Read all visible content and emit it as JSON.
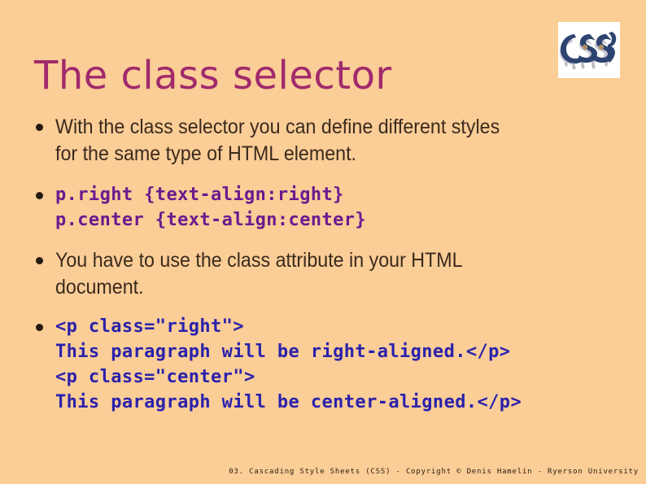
{
  "slide": {
    "title": "The class selector",
    "background_color": "#fbcd97",
    "title_color": "#a02a6c",
    "body_color": "#3a2a1c",
    "code_purple_color": "#6b1a8e",
    "code_blue_color": "#2a22ab"
  },
  "logo": {
    "alt": "CSS logo",
    "text": "C·S·S}",
    "letters_color": "#2d4370",
    "shadow_color": "#b9b9c4",
    "box_color": "#ffffff"
  },
  "bullets": [
    {
      "kind": "prose",
      "text": "With the class selector you can define different styles\nfor the same type of HTML element."
    },
    {
      "kind": "code",
      "color": "purple",
      "text": "p.right {text-align:right}\np.center {text-align:center}"
    },
    {
      "kind": "prose",
      "text": "You have to use the class attribute in your HTML\ndocument."
    },
    {
      "kind": "code",
      "color": "blue",
      "text": "<p class=\"right\">\nThis paragraph will be right-aligned.</p>\n<p class=\"center\">\nThis paragraph will be center-aligned.</p>"
    }
  ],
  "footer": {
    "text": "03. Cascading Style Sheets (CSS) - Copyright © Denis Hamelin - Ryerson University"
  }
}
